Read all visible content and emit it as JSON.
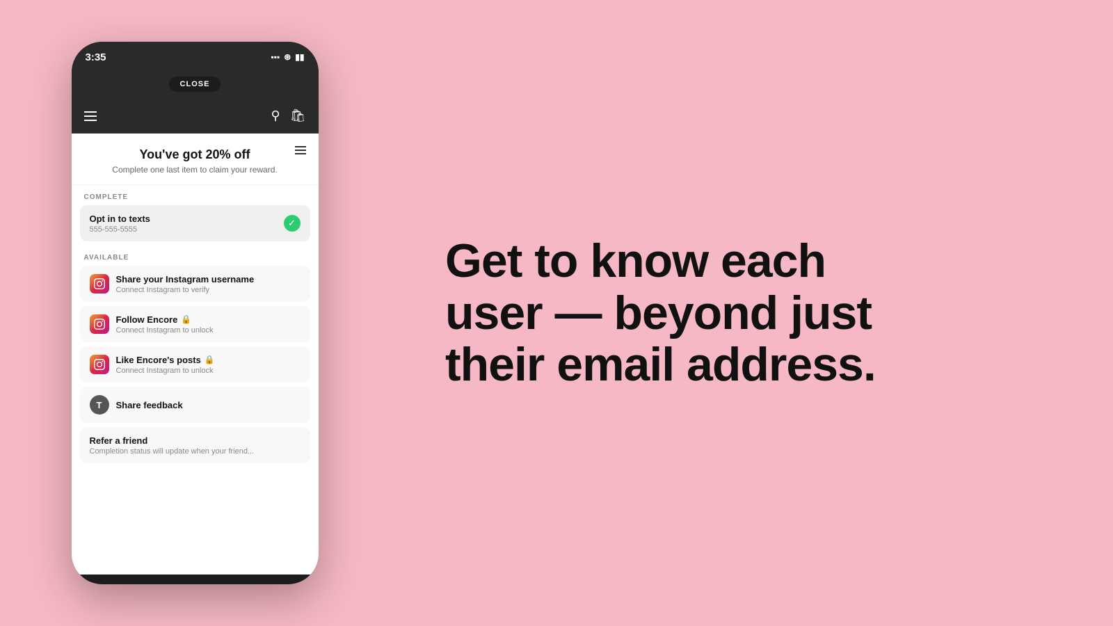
{
  "page": {
    "background_color": "#f5b8c4"
  },
  "phone": {
    "status_bar": {
      "time": "3:35"
    },
    "close_button": "CLOSE",
    "card": {
      "title": "You've got 20% off",
      "subtitle": "Complete one last item to claim your reward."
    },
    "sections": {
      "complete_label": "COMPLETE",
      "available_label": "AVAILABLE"
    },
    "completed_items": [
      {
        "id": "opt-in-texts",
        "title": "Opt in to texts",
        "subtitle": "555-555-5555",
        "status": "completed"
      }
    ],
    "available_items": [
      {
        "id": "share-instagram",
        "icon_type": "instagram",
        "title": "Share your Instagram username",
        "subtitle": "Connect Instagram to verify",
        "locked": false
      },
      {
        "id": "follow-encore",
        "icon_type": "instagram",
        "title": "Follow Encore",
        "subtitle": "Connect Instagram to unlock",
        "locked": true
      },
      {
        "id": "like-posts",
        "icon_type": "instagram",
        "title": "Like Encore's posts",
        "subtitle": "Connect Instagram to unlock",
        "locked": true
      },
      {
        "id": "share-feedback",
        "icon_type": "text",
        "icon_letter": "T",
        "title": "Share feedback",
        "subtitle": "",
        "locked": false
      },
      {
        "id": "refer-friend",
        "icon_type": "none",
        "title": "Refer a friend",
        "subtitle": "Completion status will update when your friend...",
        "locked": false
      }
    ]
  },
  "hero": {
    "line1": "Get to know each",
    "line2": "user — beyond just",
    "line3": "their email address."
  }
}
